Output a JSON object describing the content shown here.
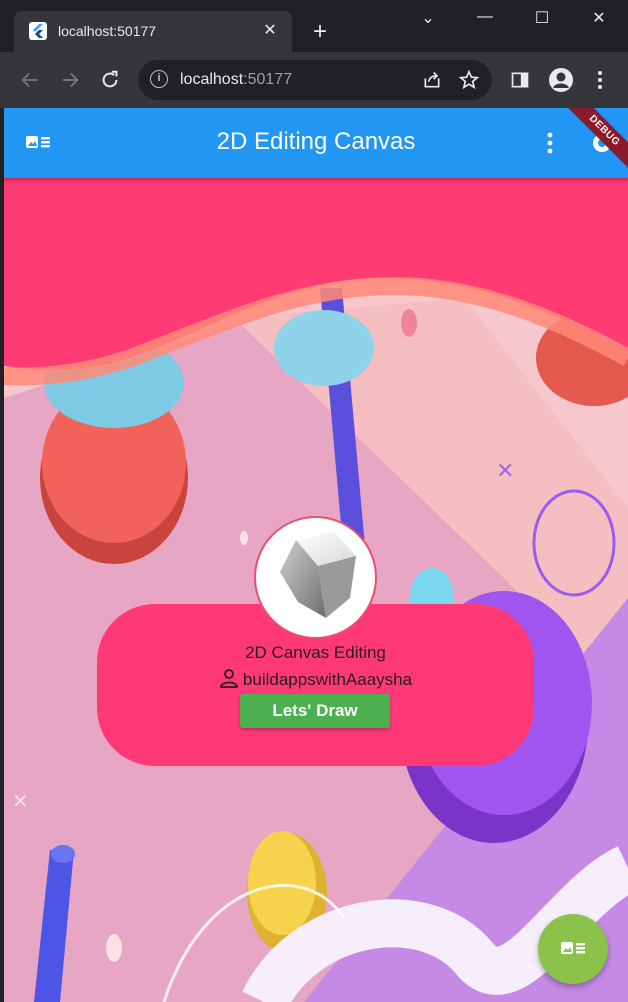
{
  "browser": {
    "tab_title": "localhost:50177",
    "url_host": "localhost",
    "url_port": ":50177",
    "controls": {
      "minimize": "—",
      "maximize": "☐",
      "close": "✕",
      "tab_close": "✕",
      "new_tab": "+",
      "tab_menu": "⌄"
    }
  },
  "appbar": {
    "title": "2D Editing Canvas",
    "debug_banner": "DEBUG",
    "color": "#2196f3"
  },
  "card": {
    "title": "2D Canvas Editing",
    "author": "buildappswithAaaysha",
    "button_label": "Lets' Draw",
    "card_color": "#ff3975",
    "button_color": "#4caf50"
  },
  "fab": {
    "color": "#8bc34a",
    "icon": "image-list-icon"
  }
}
